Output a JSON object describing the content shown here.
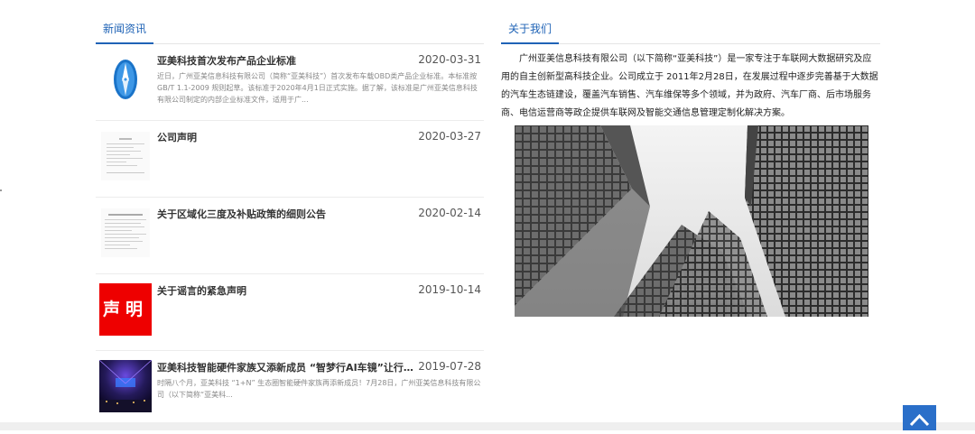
{
  "news": {
    "tab_label": "新闻资讯",
    "items": [
      {
        "title": "亚美科技首次发布产品企业标准",
        "date": "2020-03-31",
        "summary": "近日，广州亚美信息科技有限公司（简称“亚美科技”）首次发布车载OBD类产品企业标准。本标准按 GB/T 1.1-2009 规则起草。该标准于2020年4月1日正式实施。据了解，该标准是广州亚美信息科技有限公司制定的内部企业标准文件，适用于广...",
        "thumb_icon": "logo-icon"
      },
      {
        "title": "公司声明",
        "date": "2020-03-27",
        "summary": "",
        "thumb_icon": "document-thumbnail"
      },
      {
        "title": "关于区域化三度及补贴政策的细则公告",
        "date": "2020-02-14",
        "summary": "",
        "thumb_icon": "document-thumbnail"
      },
      {
        "title": "关于谣言的紧急声明",
        "date": "2019-10-14",
        "summary": "",
        "thumb_text": "声明"
      },
      {
        "title": "亚美科技智能硬件家族又添新成员 “智梦行AI车镜”让行车...",
        "date": "2019-07-28",
        "summary": "时隔八个月，亚美科技 “1+N” 生态圈智能硬件家族再添新成员！7月28日，广州亚美信息科技有限公司（以下简称“亚美科...",
        "thumb_icon": "event-stage-photo"
      }
    ]
  },
  "about": {
    "tab_label": "关于我们",
    "text": "广州亚美信息科技有限公司（以下简称“亚美科技”）是一家专注于车联网大数据研究及应用的自主创新型高科技企业。公司成立于 2011年2月28日，在发展过程中逐步完善基于大数据的汽车生态链建设，覆盖汽车销售、汽车维保等多个领域，并为政府、汽车厂商、后市场服务商、电信运营商等政企提供车联网及智能交通信息管理定制化解决方案。",
    "photo_icon": "skyscraper-photo"
  },
  "colors": {
    "accent": "#1f63b6",
    "back_to_top": "#2a6fc9",
    "statement_red": "#ee0000"
  },
  "back_to_top_icon": "chevron-up-icon"
}
